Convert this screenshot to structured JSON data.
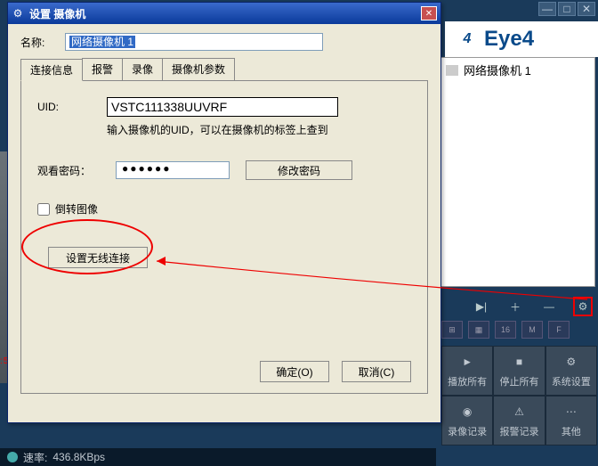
{
  "main": {
    "brand": "Eye4",
    "device_label": "网络摄像机 1",
    "window_buttons": {
      "min": "—",
      "max": "□",
      "close": "✕"
    },
    "toolbar": {
      "play": "▶|",
      "add": "＋",
      "remove": "—",
      "settings": "⚙"
    },
    "layout_buttons": [
      "⊞",
      "▦",
      "16",
      "M",
      "F"
    ],
    "bottom_buttons": {
      "row1": [
        {
          "icon": "►",
          "label": "播放所有",
          "name": "play-all-button"
        },
        {
          "icon": "■",
          "label": "停止所有",
          "name": "stop-all-button"
        },
        {
          "icon": "⚙",
          "label": "系统设置",
          "name": "system-settings-button"
        }
      ],
      "row2": [
        {
          "icon": "◉",
          "label": "录像记录",
          "name": "record-log-button"
        },
        {
          "icon": "⚠",
          "label": "报警记录",
          "name": "alarm-log-button"
        },
        {
          "icon": "⋯",
          "label": "其他",
          "name": "other-button"
        }
      ]
    },
    "status": {
      "prefix": "速率:",
      "value": "436.8KBps"
    },
    "edge_ts": ":5"
  },
  "dialog": {
    "title": "设置 摄像机",
    "name_label": "名称:",
    "name_value": "网络摄像机 1",
    "tabs": [
      "连接信息",
      "报警",
      "录像",
      "摄像机参数"
    ],
    "uid_label": "UID:",
    "uid_value": "VSTC111338UUVRF",
    "uid_hint": "输入摄像机的UID，可以在摄像机的标签上查到",
    "pwd_label": "观看密码：",
    "pwd_value": "●●●●●●",
    "pwd_change": "修改密码",
    "flip_label": "倒转图像",
    "wireless_label": "设置无线连接",
    "ok": "确定(O)",
    "cancel": "取消(C)",
    "close_icon": "✕"
  }
}
